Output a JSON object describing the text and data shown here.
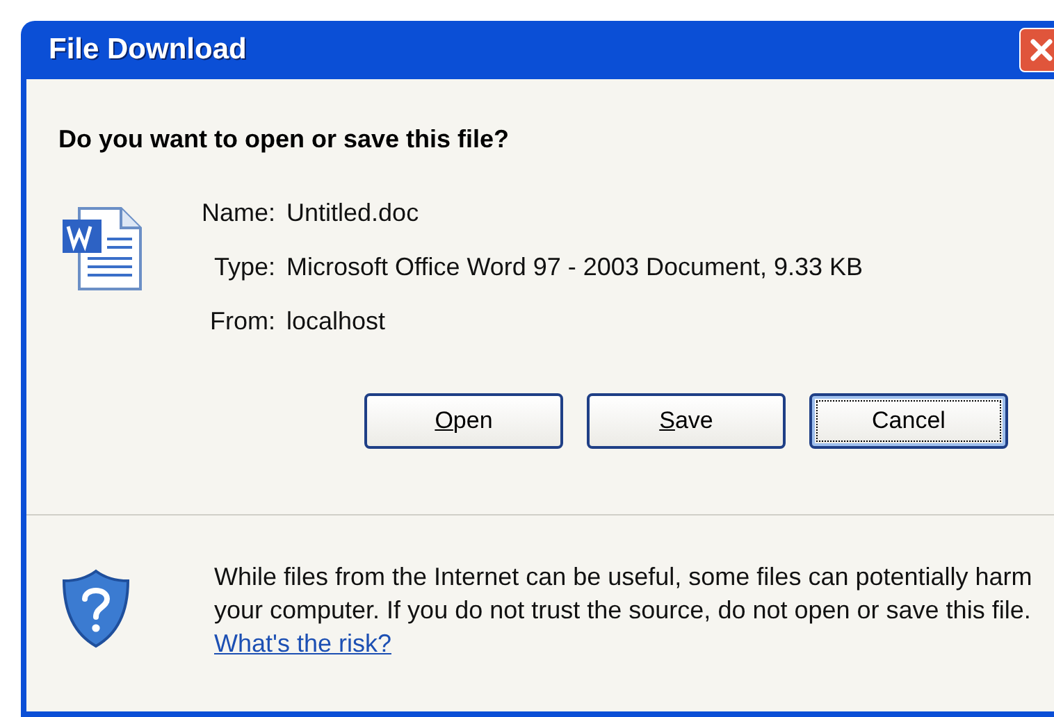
{
  "window": {
    "title": "File Download"
  },
  "heading": "Do you want to open or save this file?",
  "fields": [
    {
      "label": "Name:",
      "value": "Untitled.doc"
    },
    {
      "label": "Type:",
      "value": "Microsoft Office Word 97 - 2003 Document, 9.33 KB"
    },
    {
      "label": "From:",
      "value": "localhost"
    }
  ],
  "buttons": [
    {
      "label": "Open",
      "access_key": true,
      "focused": false
    },
    {
      "label": "Save",
      "access_key": true,
      "focused": false
    },
    {
      "label": "Cancel",
      "access_key": false,
      "focused": true
    }
  ],
  "warning": {
    "text": "While files from the Internet can be useful, some files can potentially harm your computer. If you do not trust the source, do not open or save this file.",
    "link": "What's the risk?"
  }
}
